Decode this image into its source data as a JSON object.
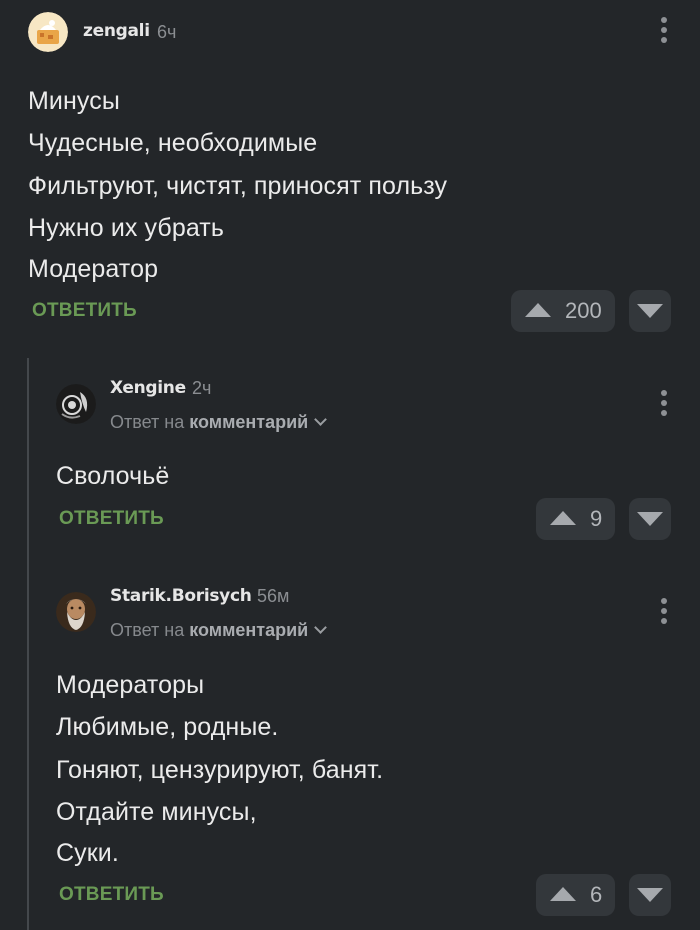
{
  "comments": [
    {
      "username": "zengali",
      "time": "6ч",
      "lines": [
        "Минусы",
        "Чудесные, необходимые",
        "Фильтруют, чистят, приносят пользу",
        "Нужно их убрать",
        "Модератор"
      ],
      "reply_label": "ОТВЕТИТЬ",
      "votes": "200"
    },
    {
      "username": "Xengine",
      "time": "2ч",
      "reply_to_prefix": "Ответ на",
      "reply_to_target": "комментарий",
      "lines": [
        "Сволочьё"
      ],
      "reply_label": "ОТВЕТИТЬ",
      "votes": "9"
    },
    {
      "username": "Starik.Borisych",
      "time": "56м",
      "reply_to_prefix": "Ответ на",
      "reply_to_target": "комментарий",
      "lines": [
        "Модераторы",
        "Любимые, родные.",
        "Гоняют, цензурируют, банят.",
        "Отдайте минусы,",
        "Суки."
      ],
      "reply_label": "ОТВЕТИТЬ",
      "votes": "6"
    }
  ],
  "colors": {
    "background": "#232629",
    "reply_accent": "#6a9a55",
    "vote_button": "#33373b"
  },
  "icons": {
    "more": "more-vertical-icon",
    "upvote": "triangle-up-icon",
    "downvote": "triangle-down-icon",
    "expand": "chevron-down-icon"
  }
}
